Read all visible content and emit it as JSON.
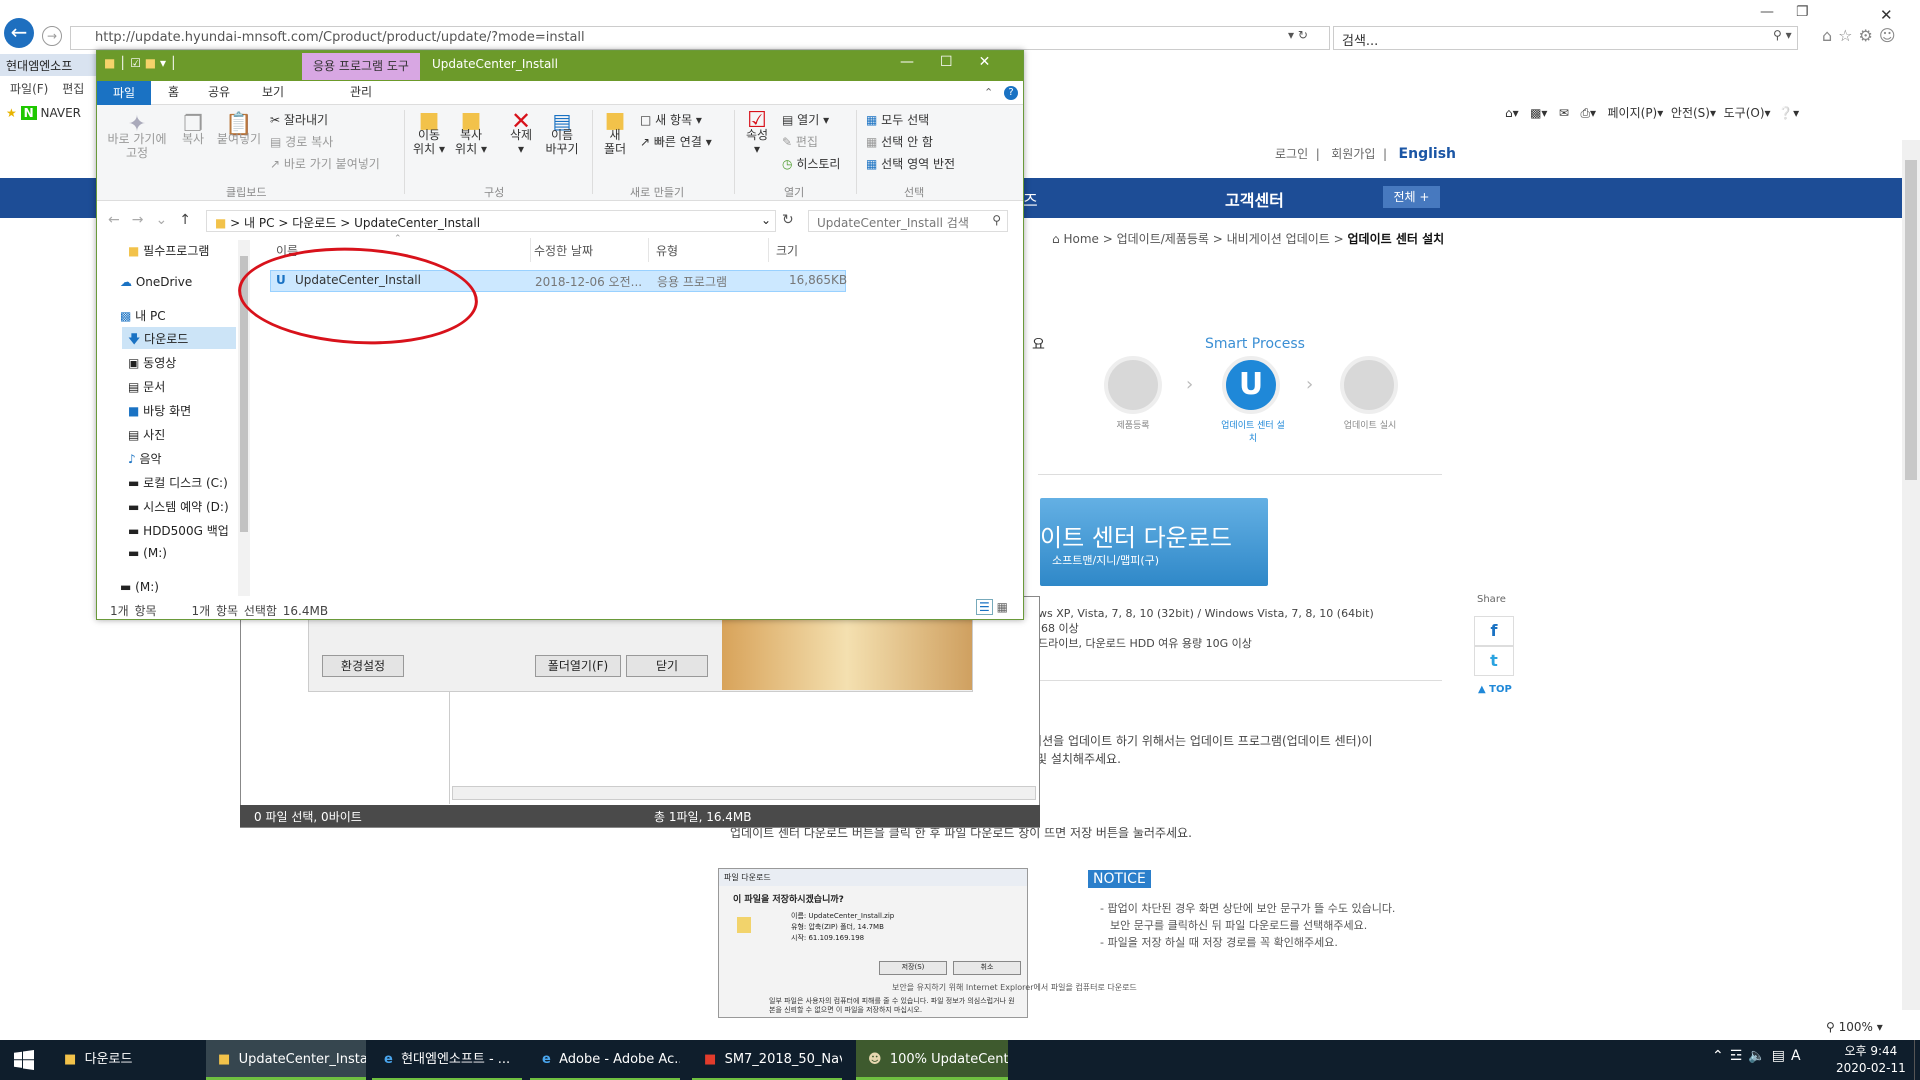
{
  "ie": {
    "url": "http://update.hyundai-mnsoft.com/Cproduct/product/update/?mode=install",
    "search_placeholder": "검색...",
    "tab_title": "현대엠엔소프",
    "menu": [
      "파일(F)",
      "편집"
    ],
    "favorite": "NAVER",
    "cmdbar": [
      "페이지(P)",
      "안전(S)",
      "도구(O)"
    ],
    "zoom": "100%"
  },
  "site": {
    "top_links": [
      "로그인",
      "회원가입"
    ],
    "english": "English",
    "nav_partial": "즈",
    "nav_cs": "고객센터",
    "nav_all": "전체 +",
    "breadcrumb": [
      "Home",
      "업데이트/제품등록",
      "내비게이션 업데이트"
    ],
    "breadcrumb_current": "업데이트 센터 설치",
    "smart_process": "Smart Process",
    "steps": [
      "제품등록",
      "업데이트 센터 설치",
      "업데이트 실시"
    ],
    "download_title": "이트 센터 다운로드",
    "download_sub": "소프트맨/지니/맵피(구)",
    "req_lines": [
      "ws XP, Vista, 7, 8, 10 (32bit) / Windows Vista, 7, 8, 10 (64bit)",
      "'68 이상",
      "드라이브, 다운로드 HDD 여유 용량 10G 이상"
    ],
    "share": "Share",
    "top": "TOP",
    "desc_lines": [
      "게이션을 업데이트 하기 위해서는 업데이트 프로그램(업데이트 센터)이",
      "및 설치해주세요."
    ],
    "desc2": "업데이트 센터 다운로드 버튼을 클릭 한 후 파일 다운로드 창이 뜨면 저장 버튼을 눌러주세요.",
    "notice": "NOTICE",
    "notice_lines": [
      "- 팝업이 차단된 경우 화면 상단에 보안 문구가 뜰 수도 있습니다.",
      "  보안 문구를 클릭하신 뒤 파일 다운로드를 선택해주세요.",
      "- 파일을 저장 하실 때 저장 경로를 꼭 확인해주세요."
    ],
    "file_dialog": {
      "title": "파일 다운로드",
      "question": "이 파일을 저장하시겠습니까?",
      "name": "이름:  UpdateCenter_Install.zip",
      "type": "유형:  압축(ZIP) 폴더, 14.7MB",
      "from": "시작:  61.109.169.198",
      "save": "저장(S)",
      "cancel": "취소",
      "warn": "일부 파일은 사용자의 컴퓨터에 피해를 줄 수 있습니다. 파일 정보가 의심스럽거나 원본을 신뢰할 수 없으면 이 파일을 저장하지 마십시오."
    },
    "security_note": "보안을 유지하기 위해 Internet Explorer에서 파일을 컴퓨터로 다운로드"
  },
  "updater": {
    "settings": "환경설정",
    "open_folder": "폴더열기(F)",
    "close": "닫기",
    "status_left": "0 파일 선택,  0바이트",
    "status_right": "총 1파일,  16.4MB"
  },
  "explorer": {
    "tool_tab": "응용 프로그램 도구",
    "title": "UpdateCenter_Install",
    "tabs": [
      "파일",
      "홈",
      "공유",
      "보기",
      "관리"
    ],
    "ribbon": {
      "pin": "바로 가기에\n고정",
      "copy": "복사",
      "paste": "붙여넣기",
      "cut": "잘라내기",
      "copy_path": "경로 복사",
      "paste_shortcut": "바로 가기 붙여넣기",
      "move_to": "이동\n위치",
      "copy_to": "복사\n위치",
      "delete": "삭제",
      "rename": "이름\n바꾸기",
      "new_folder": "새\n폴더",
      "new_item": "새 항목",
      "quick_access": "빠른 연결",
      "properties": "속성",
      "open": "열기",
      "edit": "편집",
      "history": "히스토리",
      "select_all": "모두 선택",
      "select_none": "선택 안 함",
      "invert": "선택 영역 반전",
      "groups": [
        "클립보드",
        "구성",
        "새로 만들기",
        "열기",
        "선택"
      ]
    },
    "path": [
      "내 PC",
      "다운로드",
      "UpdateCenter_Install"
    ],
    "search": "UpdateCenter_Install 검색",
    "nav": [
      "필수프로그램",
      "OneDrive",
      "내 PC",
      "다운로드",
      "동영상",
      "문서",
      "바탕 화면",
      "사진",
      "음악",
      "로컬 디스크 (C:)",
      "시스템 예약 (D:)",
      "HDD500G 백업",
      "(M:)",
      "(M:)"
    ],
    "columns": [
      "이름",
      "수정한 날짜",
      "유형",
      "크기"
    ],
    "file": {
      "name": "UpdateCenter_Install",
      "date": "2018-12-06 오전...",
      "type": "응용 프로그램",
      "size": "16,865KB"
    },
    "status": [
      "1개 항목",
      "1개 항목 선택함 16.4MB"
    ]
  },
  "taskbar": {
    "items": [
      "다운로드",
      "UpdateCenter_Install",
      "현대엠엔소프트 - ...",
      "Adobe - Adobe Ac...",
      "SM7_2018_50_Nav...",
      "100% UpdateCent..."
    ],
    "time": "오후 9:44",
    "date": "2020-02-11",
    "lang": "A"
  },
  "colors": {
    "explorer_title": "#6c9a2a",
    "site_nav": "#1d4d96",
    "highlight": "#d8121b",
    "taskbar": "#0f1e2c"
  }
}
